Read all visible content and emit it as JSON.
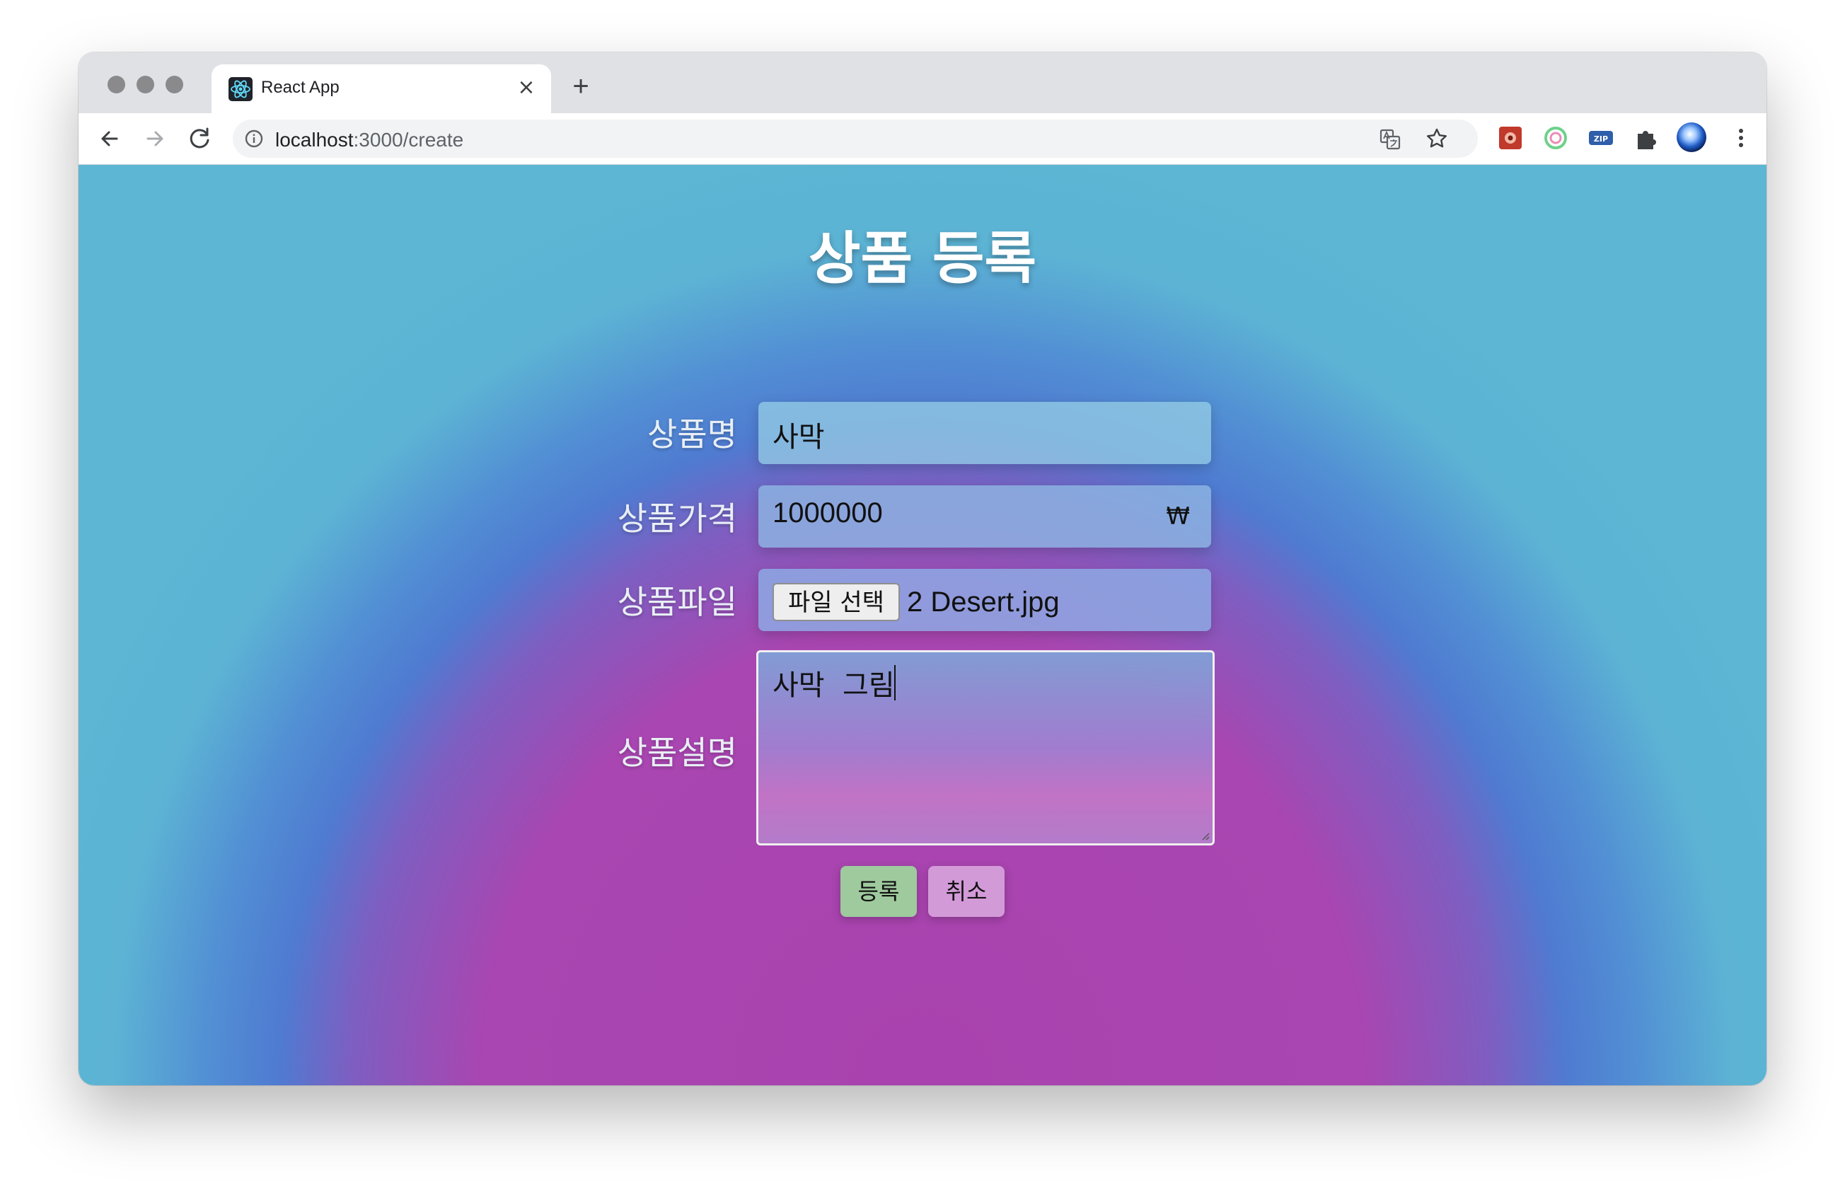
{
  "browser": {
    "tab_title": "React App",
    "tab_close": "×",
    "new_tab": "+",
    "url_host": "localhost",
    "url_path": ":3000/create"
  },
  "page": {
    "title": "상품 등록",
    "labels": {
      "name": "상품명",
      "price": "상품가격",
      "file": "상품파일",
      "description": "상품설명"
    },
    "fields": {
      "name_value": "사막",
      "price_value": "1000000",
      "currency_symbol": "₩",
      "file_button": "파일 선택",
      "file_name": "2 Desert.jpg",
      "description_value": "사막  그림"
    },
    "buttons": {
      "submit": "등록",
      "cancel": "취소"
    }
  },
  "colors": {
    "submit_button": "#9fca9e",
    "cancel_button": "#d39ad8"
  }
}
